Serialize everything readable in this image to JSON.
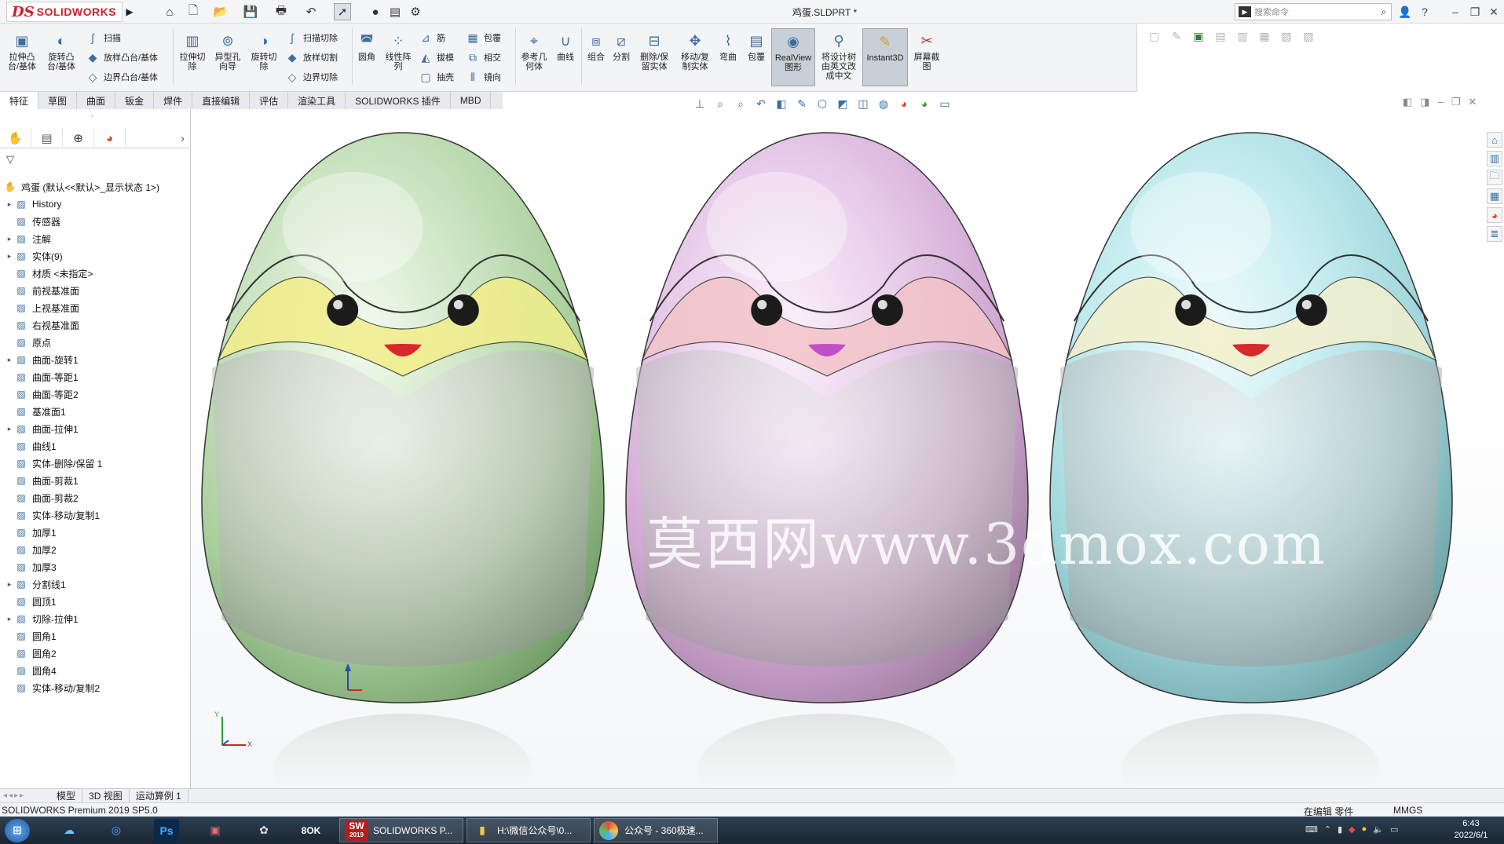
{
  "app": {
    "brand_ds": "DS",
    "brand_name": "SOLIDWORKS",
    "doc_title": "鸡蛋.SLDPRT *"
  },
  "search": {
    "placeholder": "搜索命令"
  },
  "commands": {
    "extrude_boss": "拉伸凸\n台/基体",
    "revolve_boss": "旋转凸\n台/基体",
    "sweep": "扫描",
    "loft_boss": "放样凸台/基体",
    "boundary_boss": "边界凸台/基体",
    "extrude_cut": "拉伸切\n除",
    "hole_wizard": "异型孔\n向导",
    "revolve_cut": "旋转切\n除",
    "swept_cut": "扫描切除",
    "lofted_cut": "放样切割",
    "boundary_cut": "边界切除",
    "fillet": "圆角",
    "linear_pattern": "线性阵\n列",
    "rib": "筋",
    "draft": "拔模",
    "shell": "抽壳",
    "wrap": "包覆",
    "intersect": "相交",
    "mirror": "镜向",
    "ref_geometry": "参考几\n何体",
    "curves": "曲线",
    "combine": "组合",
    "split": "分割",
    "delete_keep_body": "删除/保\n留实体",
    "move_copy_body": "移动/复\n制实体",
    "flex": "弯曲",
    "wrap2": "包覆",
    "realview": "RealView\n图形",
    "translate_tree": "将设计树\n由英文改\n成中文",
    "instant3d": "Instant3D",
    "screen_capture": "屏幕截\n图"
  },
  "tabs": [
    "特征",
    "草图",
    "曲面",
    "钣金",
    "焊件",
    "直接编辑",
    "评估",
    "渲染工具",
    "SOLIDWORKS 插件",
    "MBD"
  ],
  "tree": {
    "root": "鸡蛋 (默认<<默认>_显示状态 1>)",
    "items": [
      {
        "label": "History",
        "icon": "history-icon",
        "arrow": "▸"
      },
      {
        "label": "传感器",
        "icon": "sensor-icon",
        "arrow": ""
      },
      {
        "label": "注解",
        "icon": "annotation-icon",
        "arrow": "▸"
      },
      {
        "label": "实体(9)",
        "icon": "solid-bodies-icon",
        "arrow": "▸"
      },
      {
        "label": "材质 <未指定>",
        "icon": "material-icon",
        "arrow": ""
      },
      {
        "label": "前视基准面",
        "icon": "plane-icon",
        "arrow": ""
      },
      {
        "label": "上视基准面",
        "icon": "plane-icon",
        "arrow": ""
      },
      {
        "label": "右视基准面",
        "icon": "plane-icon",
        "arrow": ""
      },
      {
        "label": "原点",
        "icon": "origin-icon",
        "arrow": ""
      },
      {
        "label": "曲面-旋转1",
        "icon": "surface-revolve-icon",
        "arrow": "▸"
      },
      {
        "label": "曲面-等距1",
        "icon": "surface-offset-icon",
        "arrow": ""
      },
      {
        "label": "曲面-等距2",
        "icon": "surface-offset-icon",
        "arrow": ""
      },
      {
        "label": "基准面1",
        "icon": "plane-icon",
        "arrow": ""
      },
      {
        "label": "曲面-拉伸1",
        "icon": "surface-extrude-icon",
        "arrow": "▸"
      },
      {
        "label": "曲线1",
        "icon": "curve-icon",
        "arrow": ""
      },
      {
        "label": "实体-删除/保留 1",
        "icon": "delete-body-icon",
        "arrow": ""
      },
      {
        "label": "曲面-剪裁1",
        "icon": "surface-trim-icon",
        "arrow": ""
      },
      {
        "label": "曲面-剪裁2",
        "icon": "surface-trim-icon",
        "arrow": ""
      },
      {
        "label": "实体-移动/复制1",
        "icon": "move-body-icon",
        "arrow": ""
      },
      {
        "label": "加厚1",
        "icon": "thicken-icon",
        "arrow": ""
      },
      {
        "label": "加厚2",
        "icon": "thicken-icon",
        "arrow": ""
      },
      {
        "label": "加厚3",
        "icon": "thicken-icon",
        "arrow": ""
      },
      {
        "label": "分割线1",
        "icon": "split-line-icon",
        "arrow": "▸"
      },
      {
        "label": "圆顶1",
        "icon": "dome-icon",
        "arrow": ""
      },
      {
        "label": "切除-拉伸1",
        "icon": "cut-extrude-icon",
        "arrow": "▸"
      },
      {
        "label": "圆角1",
        "icon": "fillet-icon",
        "arrow": ""
      },
      {
        "label": "圆角2",
        "icon": "fillet-icon",
        "arrow": ""
      },
      {
        "label": "圆角4",
        "icon": "fillet-icon",
        "arrow": ""
      },
      {
        "label": "实体-移动/复制2",
        "icon": "move-body-icon",
        "arrow": ""
      }
    ]
  },
  "viewport": {
    "watermark": "莫西网www.3dmox.com",
    "triad_x": "X",
    "triad_y": "Y"
  },
  "bottom_tabs": [
    "模型",
    "3D 视图",
    "运动算例 1"
  ],
  "status": {
    "product": "SOLIDWORKS Premium 2019 SP5.0",
    "mode": "在编辑 零件",
    "units": "MMGS"
  },
  "taskbar": {
    "sw_window": "SOLIDWORKS P...",
    "folder_window": "H:\\微信公众号\\0...",
    "browser_window": "公众号 - 360极速...",
    "time": "6:43",
    "date": "2022/6/1",
    "sw_year": "2019"
  },
  "colors": {
    "brand": "#cc1f2d",
    "egg_green": "#9fd89a",
    "egg_pink": "#e2b7e6",
    "egg_cyan": "#9fe3ea",
    "band_yellow": "#f2ee8a",
    "band_pink": "#f3c4c8",
    "band_cream": "#f3f0cc"
  }
}
